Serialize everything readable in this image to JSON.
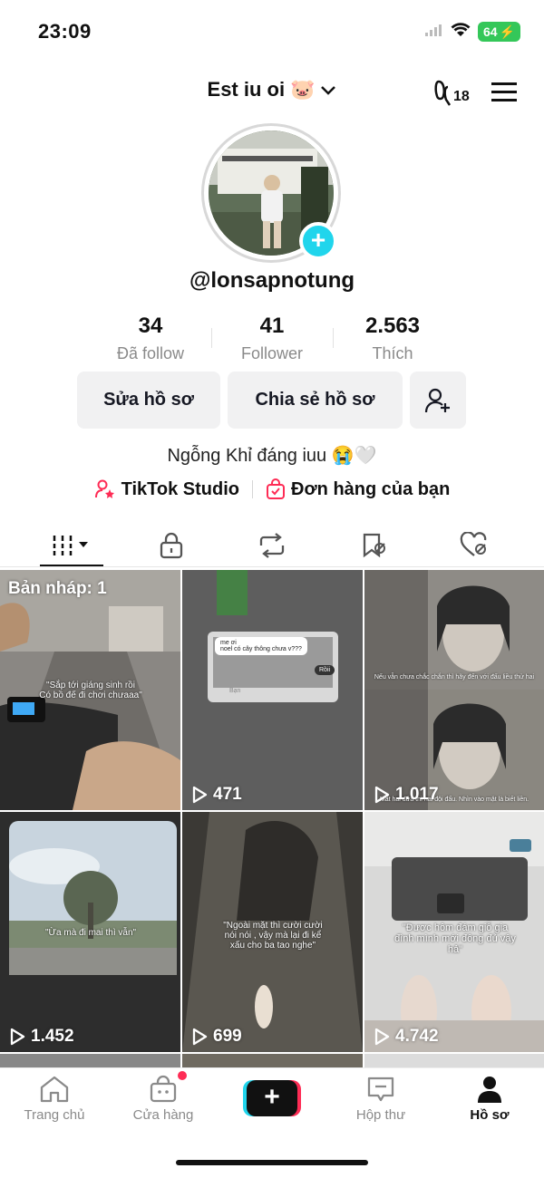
{
  "status": {
    "time": "23:09",
    "battery": "64"
  },
  "header": {
    "title": "Est iu oi",
    "views_badge": "18"
  },
  "profile": {
    "username": "@lonsapnotung"
  },
  "stats": [
    {
      "value": "34",
      "label": "Đã follow"
    },
    {
      "value": "41",
      "label": "Follower"
    },
    {
      "value": "2.563",
      "label": "Thích"
    }
  ],
  "actions": {
    "edit": "Sửa hồ sơ",
    "share": "Chia sẻ hồ sơ"
  },
  "bio": "Ngỗng Khỉ đáng iuu 😭🤍",
  "links": {
    "studio": "TikTok Studio",
    "orders": "Đơn hàng của bạn"
  },
  "tabs": [
    "videos-grid-icon",
    "lock-icon",
    "repost-icon",
    "saved-icon",
    "liked-icon"
  ],
  "videos": [
    {
      "drafts": "Bản nháp: 1",
      "caption": "\"Sắp tới giáng sinh rồi\nCó bồ đế đi chơi chưaaa\""
    },
    {
      "views": "471",
      "bubble1": "me ơi\nnoel có cây thông chưa v???",
      "bubble2": "Rồii",
      "input": "Bạn"
    },
    {
      "views": "1.017",
      "caption": "Nếu vẫn chưa chắc chắn thì hãy đến với đấu liều thử hai",
      "caption2": "Mất hai đứa thì hai đội đấu. Nhìn vào mặt là biết liền."
    },
    {
      "views": "1.452",
      "caption": "\"Ừa mà đi mai thì vẫn\""
    },
    {
      "views": "699",
      "caption": "\"Ngoài mặt thì cười cười nói nói , vậy mà lại đi kể xấu cho ba tao nghe\""
    },
    {
      "views": "4.742",
      "caption": "\"Được hôm đám giỗ gia đình mình mới đông đủ vậy hả\""
    }
  ],
  "nav": {
    "home": "Trang chủ",
    "shop": "Cửa hàng",
    "inbox": "Hộp thư",
    "profile": "Hồ sơ"
  },
  "colors": {
    "accent_cyan": "#20d5ec",
    "accent_pink": "#fe2c55",
    "battery_green": "#34c759"
  }
}
